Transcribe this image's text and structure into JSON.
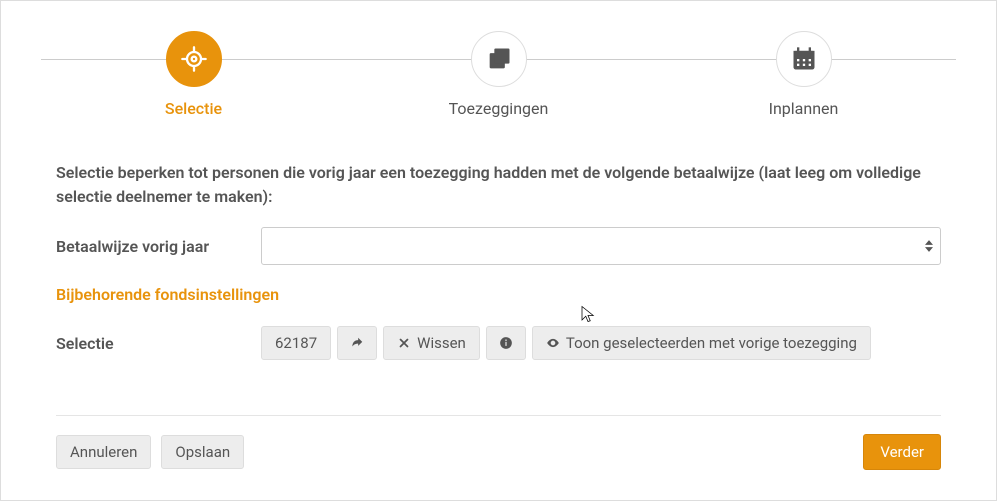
{
  "stepper": {
    "steps": [
      {
        "label": "Selectie",
        "active": true
      },
      {
        "label": "Toezeggingen",
        "active": false
      },
      {
        "label": "Inplannen",
        "active": false
      }
    ]
  },
  "intro": "Selectie beperken tot personen die vorig jaar een toezegging hadden met de volgende betaalwijze (laat leeg om volledige selectie deelnemer te maken):",
  "form": {
    "betaalwijze_label": "Betaalwijze vorig jaar",
    "betaalwijze_value": ""
  },
  "section_title": "Bijbehorende fondsinstellingen",
  "selectie": {
    "label": "Selectie",
    "id": "62187",
    "wissen": "Wissen",
    "toon": "Toon geselecteerden met vorige toezegging"
  },
  "footer": {
    "annuleren": "Annuleren",
    "opslaan": "Opslaan",
    "verder": "Verder"
  }
}
